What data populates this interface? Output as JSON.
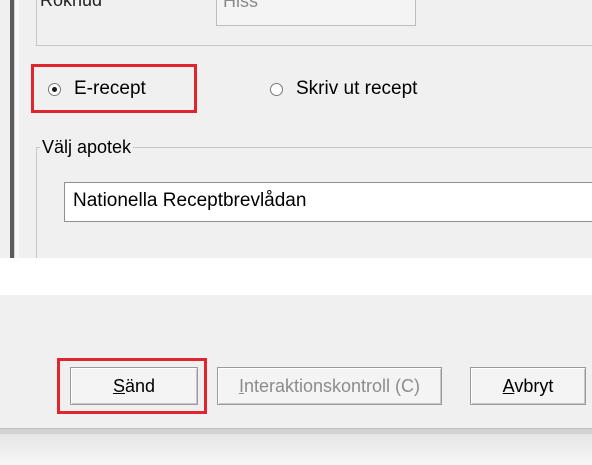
{
  "top": {
    "cut_label": "Rökhud",
    "cut_value": "Hiss"
  },
  "prescription_type": {
    "options": [
      {
        "label": "E-recept",
        "selected": true
      },
      {
        "label": "Skriv ut recept",
        "selected": false
      }
    ]
  },
  "pharmacy": {
    "legend": "Välj apotek",
    "value": "Nationella Receptbrevlådan"
  },
  "buttons": {
    "send": {
      "prefix": "",
      "accel": "S",
      "rest": "änd"
    },
    "interaction": {
      "accel": "I",
      "rest": "nteraktionskontroll (C)"
    },
    "cancel": {
      "accel": "A",
      "rest": "vbryt"
    }
  },
  "colors": {
    "highlight": "#e0252e",
    "dialog_bg": "#f0f0f0"
  }
}
